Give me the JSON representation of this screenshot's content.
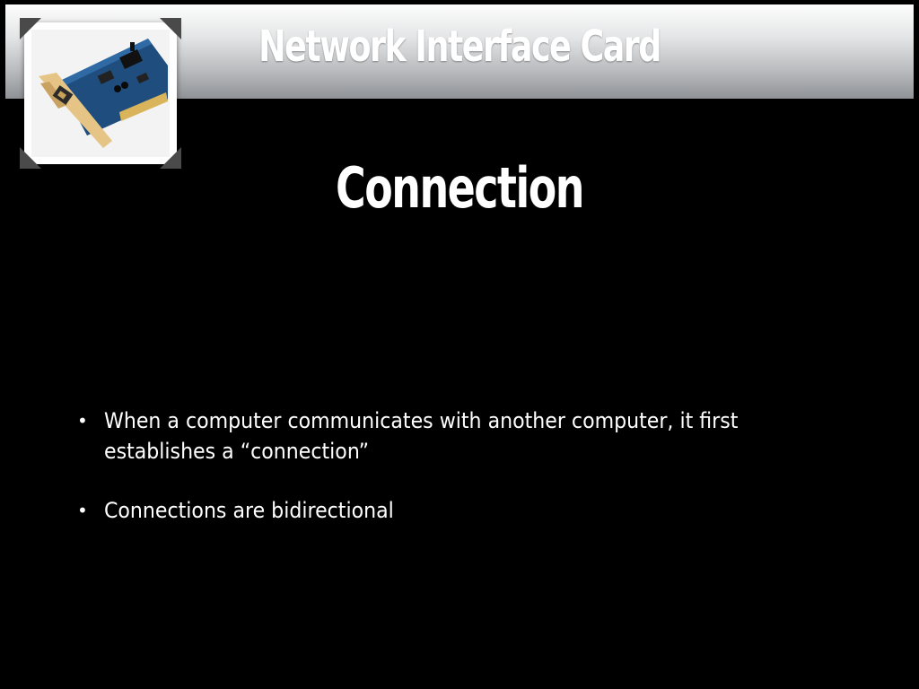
{
  "header": {
    "title": "Network Interface Card"
  },
  "slide": {
    "title": "Connection",
    "bullets": [
      "When a computer communicates with another computer, it first establishes a “connection”",
      "Connections are bidirectional"
    ],
    "bullet_glyph": "•"
  },
  "colors": {
    "background": "#000000",
    "text": "#ffffff",
    "header_gradient_top": "#fdfdfd",
    "header_gradient_bottom": "#8f9296",
    "frame_corner": "#4a4a4a"
  },
  "photo": {
    "icon": "network-card-photo-icon"
  }
}
